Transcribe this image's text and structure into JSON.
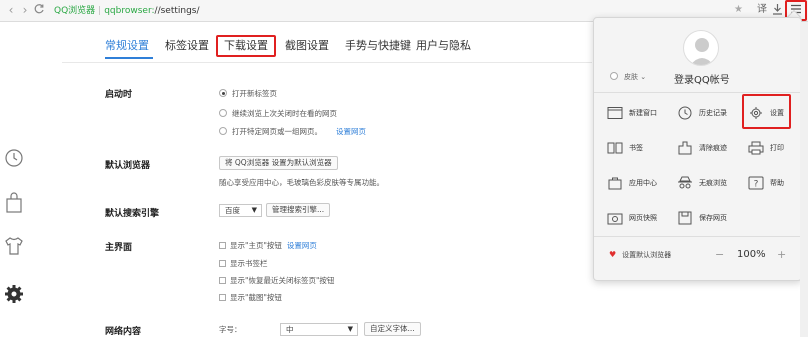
{
  "toolbar": {
    "brand": "QQ浏览器",
    "scheme": "qqbrowser:",
    "path": "//settings/",
    "translate_label": "译"
  },
  "tabs": [
    {
      "label": "常规设置"
    },
    {
      "label": "标签设置"
    },
    {
      "label": "下载设置"
    },
    {
      "label": "截图设置"
    },
    {
      "label": "手势与快捷键"
    },
    {
      "label": "用户与隐私"
    }
  ],
  "startup": {
    "title": "启动时",
    "options": [
      "打开新标签页",
      "继续浏览上次关闭时在看的网页",
      "打开特定网页或一组网页。"
    ],
    "set_pages_link": "设置网页"
  },
  "default_browser": {
    "title": "默认浏览器",
    "button": "将 QQ浏览器 设置为默认浏览器",
    "note": "随心享受应用中心，毛玻璃色彩皮肤等专属功能。"
  },
  "search": {
    "title": "默认搜索引擎",
    "engine": "百度",
    "manage_button": "管理搜索引擎..."
  },
  "home": {
    "title": "主界面",
    "options": [
      "显示\"主页\"按钮",
      "显示书签栏",
      "显示\"恢复最近关闭标签页\"按钮",
      "显示\"截图\"按钮"
    ],
    "set_home_link": "设置网页"
  },
  "web_content": {
    "title": "网络内容",
    "font_size_label": "字号：",
    "font_size_value": "中",
    "custom_font_button": "自定义字体..."
  },
  "menu": {
    "login": "登录QQ帐号",
    "skin": "皮肤",
    "items": [
      {
        "label": "新建窗口",
        "icon": "new-window-icon"
      },
      {
        "label": "历史记录",
        "icon": "history-icon"
      },
      {
        "label": "设置",
        "icon": "gear-icon"
      },
      {
        "label": "书签",
        "icon": "bookmark-icon"
      },
      {
        "label": "清除痕迹",
        "icon": "clear-icon"
      },
      {
        "label": "打印",
        "icon": "print-icon"
      },
      {
        "label": "应用中心",
        "icon": "app-center-icon"
      },
      {
        "label": "无痕浏览",
        "icon": "incognito-icon"
      },
      {
        "label": "帮助",
        "icon": "help-icon"
      },
      {
        "label": "网页快照",
        "icon": "snapshot-icon"
      },
      {
        "label": "保存网页",
        "icon": "save-page-icon"
      }
    ],
    "default_browser": "设置默认浏览器",
    "zoom_minus": "−",
    "zoom_value": "100%",
    "zoom_plus": "+"
  },
  "colors": {
    "accent": "#2f7fd8",
    "brand_green": "#2aa844",
    "highlight_red": "#e02020"
  }
}
